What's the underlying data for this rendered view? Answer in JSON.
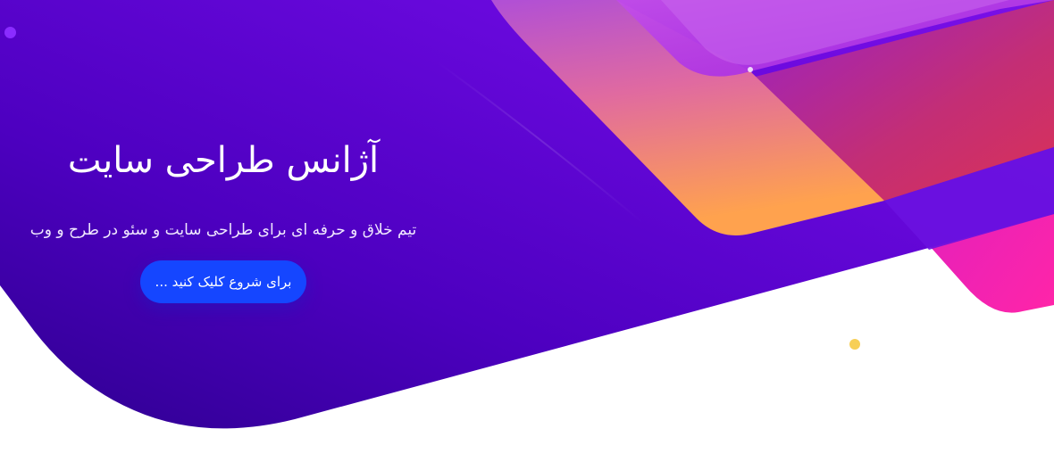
{
  "hero": {
    "title": "آژانس طراحی سایت",
    "subtitle": "تیم خلاق و حرفه ای برای طراحی سایت و سئو در طرح و وب",
    "cta_label": "برای شروع کلیک کنید ..."
  },
  "colors": {
    "primary_dark": "#34009a",
    "primary": "#5a06d4",
    "accent_orange": "#ff9a52",
    "accent_pink": "#ff2fb0",
    "button": "#1546ff",
    "dot_purple": "#8a2cff",
    "dot_yellow": "#f7cf56"
  }
}
